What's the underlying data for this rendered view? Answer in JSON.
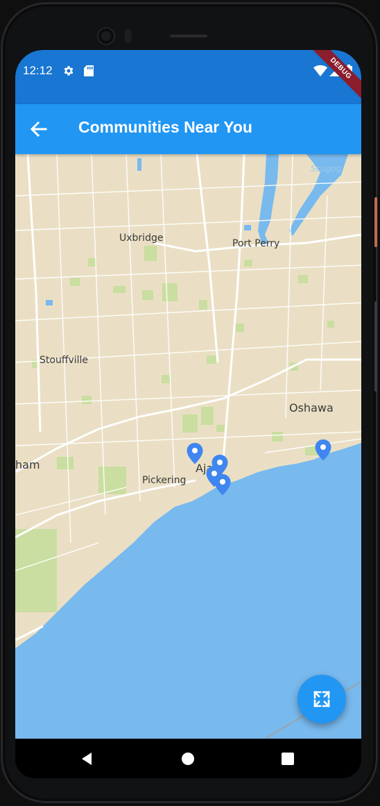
{
  "status_bar": {
    "time": "12:12",
    "icons": [
      "settings-icon",
      "sd-card-icon",
      "wifi-icon",
      "signal-icon",
      "battery-icon"
    ],
    "debug_banner": "DEBUG"
  },
  "app_bar": {
    "back_icon": "arrow-back-icon",
    "title": "Communities Near You",
    "color": "#2196f3",
    "status_color": "#1976d2"
  },
  "map": {
    "land_color": "#eadfc4",
    "water_color": "#78b9ee",
    "park_color": "#c9dea0",
    "labels": {
      "scugog": "Scugog",
      "uxbridge": "Uxbridge",
      "port_perry": "Port Perry",
      "stouffville": "Stouffville",
      "oshawa": "Oshawa",
      "markham_partial": "ham",
      "ajax_partial": "Aja",
      "pickering": "Pickering"
    },
    "markers_count": 5,
    "marker_color": "#3f86f0"
  },
  "fab": {
    "icon": "fullscreen-icon"
  },
  "nav_bar": {
    "buttons": [
      "back-triangle-icon",
      "home-circle-icon",
      "recents-square-icon"
    ]
  }
}
